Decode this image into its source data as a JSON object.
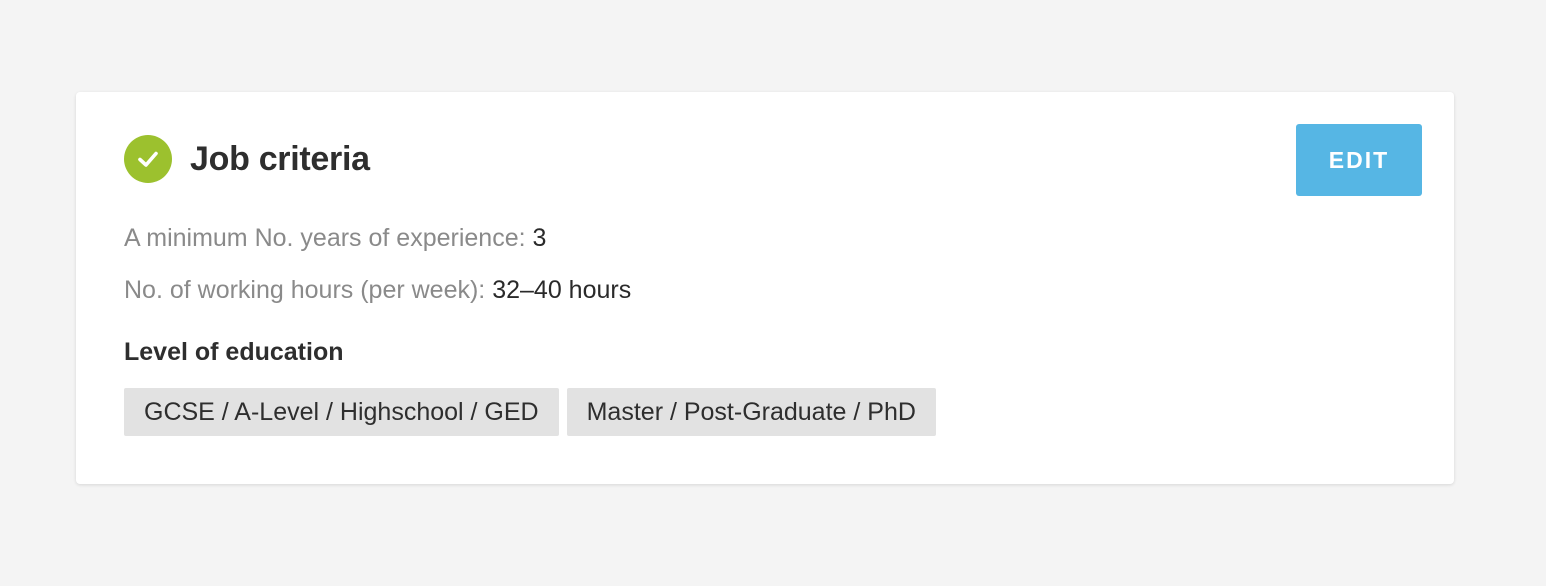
{
  "card": {
    "title": "Job criteria",
    "status_icon": "check-circle-icon",
    "status_color": "#9cc12e",
    "edit_label": "EDIT",
    "edit_color": "#56b6e4",
    "criteria": [
      {
        "label": "A minimum No. years of experience: ",
        "value": "3"
      },
      {
        "label": "No. of working hours (per week): ",
        "value": "32–40 hours"
      }
    ],
    "education": {
      "heading": "Level of education",
      "tags": [
        "GCSE / A-Level / Highschool / GED",
        "Master / Post-Graduate / PhD"
      ]
    }
  }
}
